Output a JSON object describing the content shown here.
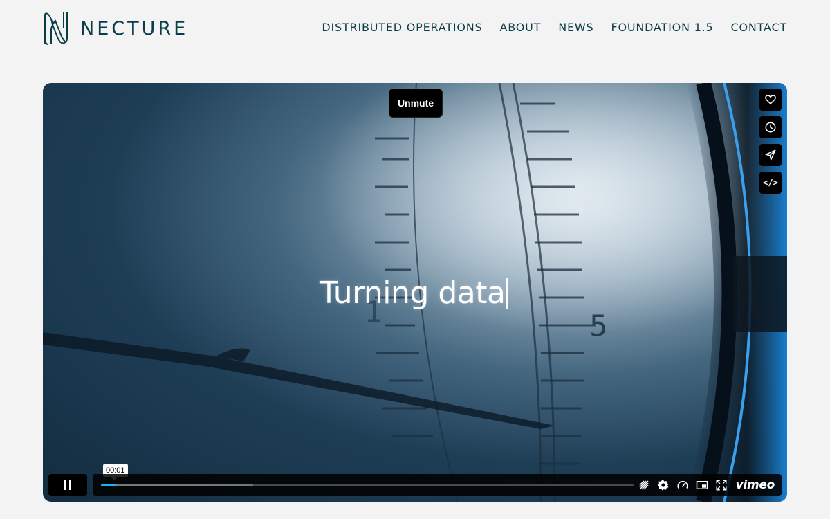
{
  "brand": {
    "name": "NECTURE",
    "logo_icon": "n-monogram-icon",
    "color": "#0b3c49"
  },
  "nav": {
    "items": [
      {
        "label": "DISTRIBUTED OPERATIONS"
      },
      {
        "label": "ABOUT"
      },
      {
        "label": "NEWS"
      },
      {
        "label": "FOUNDATION 1.5"
      },
      {
        "label": "CONTACT"
      }
    ]
  },
  "video": {
    "caption": "Turning data",
    "unmute_label": "Unmute",
    "side_buttons": [
      {
        "icon": "heart-icon"
      },
      {
        "icon": "clock-icon"
      },
      {
        "icon": "send-icon"
      },
      {
        "icon": "embed-icon",
        "label": "</>"
      }
    ],
    "controls": {
      "current_time": "00:01",
      "progress": 0.027,
      "buffered": 0.286,
      "progress_color": "#19b1f0",
      "icons": [
        "hd-off-icon",
        "settings-icon",
        "speed-icon",
        "pip-icon",
        "fullscreen-icon"
      ],
      "player_brand": "vimeo"
    }
  }
}
